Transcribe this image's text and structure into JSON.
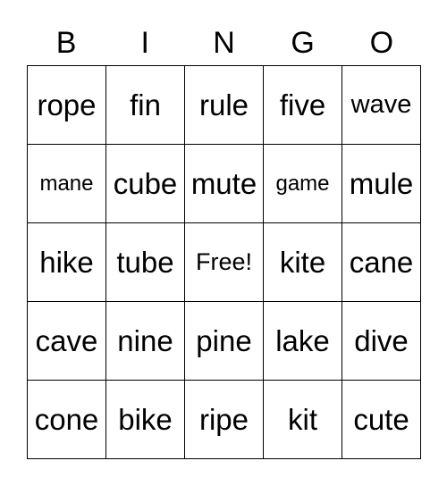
{
  "header": [
    "B",
    "I",
    "N",
    "G",
    "O"
  ],
  "rows": [
    [
      "rope",
      "fin",
      "rule",
      "five",
      "wave"
    ],
    [
      "mane",
      "cube",
      "mute",
      "game",
      "mule"
    ],
    [
      "hike",
      "tube",
      "Free!",
      "kite",
      "cane"
    ],
    [
      "cave",
      "nine",
      "pine",
      "lake",
      "dive"
    ],
    [
      "cone",
      "bike",
      "ripe",
      "kit",
      "cute"
    ]
  ]
}
